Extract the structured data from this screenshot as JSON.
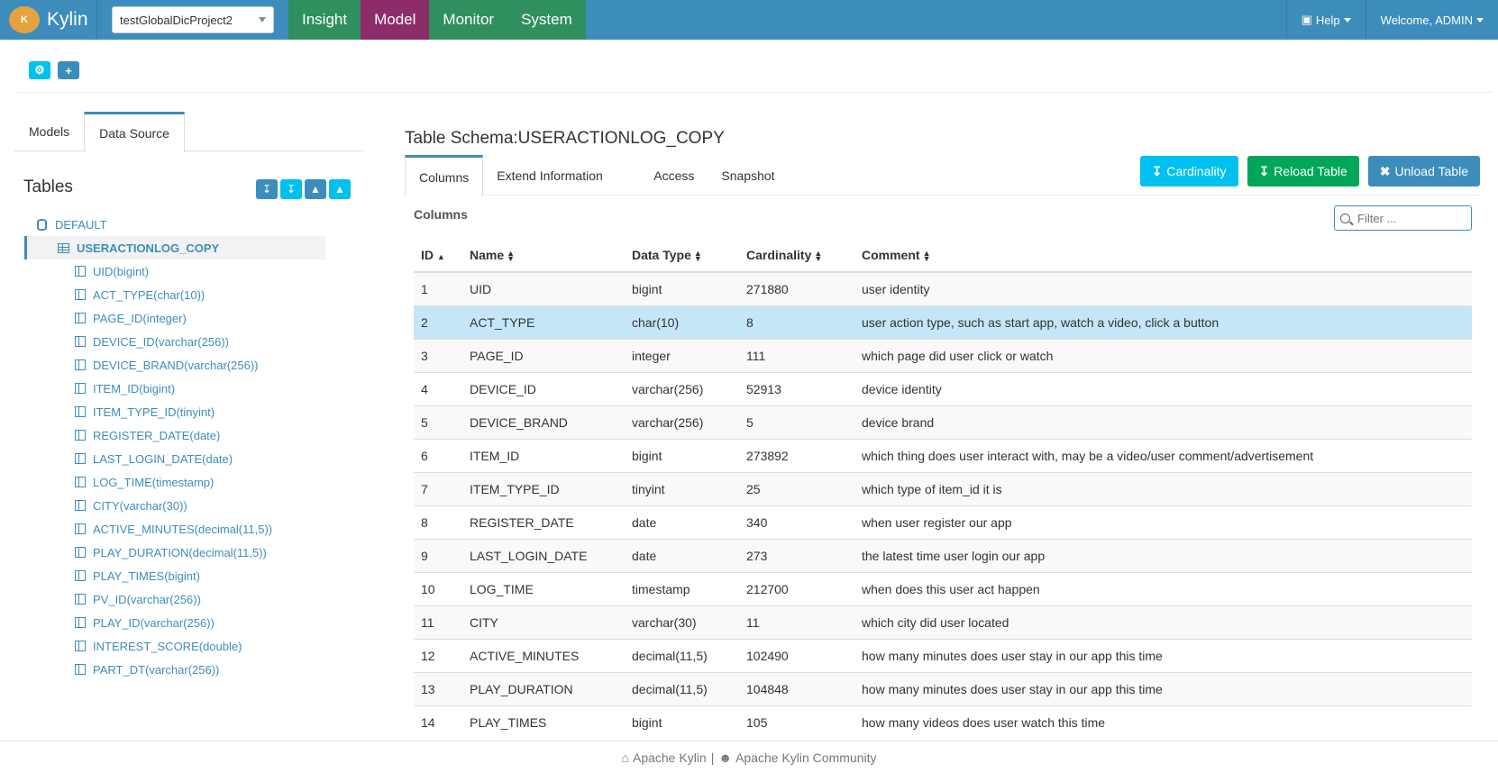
{
  "navbar": {
    "brand": "Kylin",
    "project": "testGlobalDicProject2",
    "tabs": [
      "Insight",
      "Model",
      "Monitor",
      "System"
    ],
    "active_tab": "Model",
    "help": "Help",
    "welcome": "Welcome, ADMIN",
    "colors": {
      "bar": "#3c8dbc",
      "tab": "#2f8f5f",
      "active_tab": "#8e2b69"
    }
  },
  "left": {
    "tabs": [
      "Models",
      "Data Source"
    ],
    "active_tab": "Data Source",
    "tables_title": "Tables",
    "database": "DEFAULT",
    "table": "USERACTIONLOG_COPY",
    "columns": [
      "UID(bigint)",
      "ACT_TYPE(char(10))",
      "PAGE_ID(integer)",
      "DEVICE_ID(varchar(256))",
      "DEVICE_BRAND(varchar(256))",
      "ITEM_ID(bigint)",
      "ITEM_TYPE_ID(tinyint)",
      "REGISTER_DATE(date)",
      "LAST_LOGIN_DATE(date)",
      "LOG_TIME(timestamp)",
      "CITY(varchar(30))",
      "ACTIVE_MINUTES(decimal(11,5))",
      "PLAY_DURATION(decimal(11,5))",
      "PLAY_TIMES(bigint)",
      "PV_ID(varchar(256))",
      "PLAY_ID(varchar(256))",
      "INTEREST_SCORE(double)",
      "PART_DT(varchar(256))"
    ]
  },
  "main": {
    "schema_title": "Table Schema:USERACTIONLOG_COPY",
    "tabs": [
      "Columns",
      "Extend Information",
      "Access",
      "Snapshot"
    ],
    "active_tab": "Columns",
    "buttons": {
      "cardinality": "Cardinality",
      "reload": "Reload Table",
      "unload": "Unload Table"
    },
    "columns_label": "Columns",
    "filter_placeholder": "Filter ...",
    "table": {
      "headers": [
        "ID",
        "Name",
        "Data Type",
        "Cardinality",
        "Comment"
      ],
      "selected_row": 2,
      "rows": [
        [
          "1",
          "UID",
          "bigint",
          "271880",
          "user identity"
        ],
        [
          "2",
          "ACT_TYPE",
          "char(10)",
          "8",
          "user action type, such as start app, watch a video, click a button"
        ],
        [
          "3",
          "PAGE_ID",
          "integer",
          "111",
          "which page did user click or watch"
        ],
        [
          "4",
          "DEVICE_ID",
          "varchar(256)",
          "52913",
          "device identity"
        ],
        [
          "5",
          "DEVICE_BRAND",
          "varchar(256)",
          "5",
          "device brand"
        ],
        [
          "6",
          "ITEM_ID",
          "bigint",
          "273892",
          "which thing does user interact with, may be a video/user comment/advertisement"
        ],
        [
          "7",
          "ITEM_TYPE_ID",
          "tinyint",
          "25",
          "which type of item_id it is"
        ],
        [
          "8",
          "REGISTER_DATE",
          "date",
          "340",
          "when user register our app"
        ],
        [
          "9",
          "LAST_LOGIN_DATE",
          "date",
          "273",
          "the latest time user login our app"
        ],
        [
          "10",
          "LOG_TIME",
          "timestamp",
          "212700",
          "when does this user act happen"
        ],
        [
          "11",
          "CITY",
          "varchar(30)",
          "11",
          "which city did user located"
        ],
        [
          "12",
          "ACTIVE_MINUTES",
          "decimal(11,5)",
          "102490",
          "how many minutes does user stay in our app this time"
        ],
        [
          "13",
          "PLAY_DURATION",
          "decimal(11,5)",
          "104848",
          "how many minutes does user stay in our app this time"
        ],
        [
          "14",
          "PLAY_TIMES",
          "bigint",
          "105",
          "how many videos does user watch this time"
        ]
      ]
    }
  },
  "footer": {
    "left": "Apache Kylin",
    "separator": "|",
    "right": "Apache Kylin Community"
  }
}
